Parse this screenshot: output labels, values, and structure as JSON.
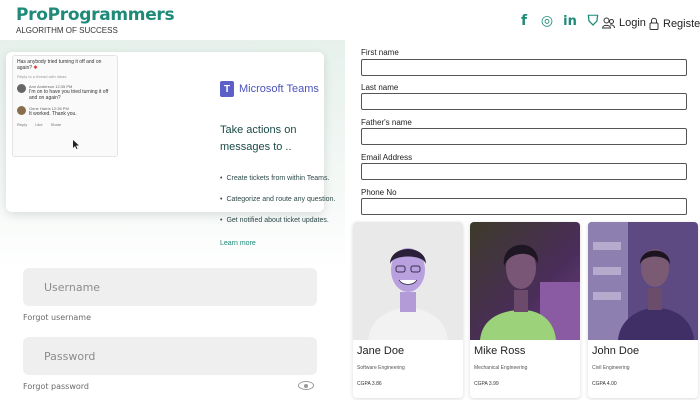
{
  "brand": {
    "title": "ProProgrammers",
    "tagline": "ALGORITHM OF SUCCESS"
  },
  "nav": {
    "social": [
      {
        "name": "facebook-icon",
        "glyph": "f"
      },
      {
        "name": "instagram-icon",
        "glyph": "◎"
      },
      {
        "name": "linkedin-icon",
        "glyph": "in"
      },
      {
        "name": "badge-icon",
        "glyph": "⛉"
      }
    ],
    "login_label": "Login",
    "register_label": "Register"
  },
  "promo": {
    "chat": {
      "title": "Has anybody tried turning it off and on again?",
      "subtitle": "Reply to a thread with ideas",
      "messages": [
        {
          "name": "Ann Anderson  12:35 PM",
          "text": "I'm on to have you tried turning it off and on again?"
        },
        {
          "name": "Gene Harris  12:36 PM",
          "text": "It worked. Thank you."
        }
      ],
      "actions": [
        "Reply",
        "Like",
        "Share"
      ]
    },
    "teams_brand": "Microsoft Teams",
    "headline": "Take actions on messages to ..",
    "bullets": [
      "Create tickets from within Teams.",
      "Categorize and route any question.",
      "Get notified about ticket updates."
    ],
    "learn_more": "Learn more"
  },
  "login": {
    "username_placeholder": "Username",
    "forgot_username": "Forgot username",
    "password_placeholder": "Password",
    "forgot_password": "Forgot password"
  },
  "registration": {
    "fields": [
      {
        "label": "First name"
      },
      {
        "label": "Last name"
      },
      {
        "label": "Father's name"
      },
      {
        "label": "Email Address"
      },
      {
        "label": "Phone No"
      }
    ]
  },
  "profiles": [
    {
      "name": "Jane Doe",
      "department": "Software Engineering",
      "cgpa": "CGPA 3.86"
    },
    {
      "name": "Mike Ross",
      "department": "Mechanical Engineering",
      "cgpa": "CGPA 3.99"
    },
    {
      "name": "John Doe",
      "department": "Civil Engineering",
      "cgpa": "CGPA 4.00"
    }
  ],
  "colors": {
    "brand": "#1e8a78",
    "teams": "#5b5fc7"
  }
}
